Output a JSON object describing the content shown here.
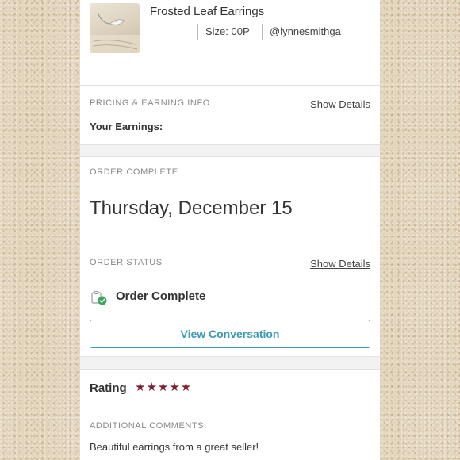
{
  "item": {
    "title": "Frosted Leaf Earrings",
    "size": "Size: 00P",
    "seller": "@lynnesmithga"
  },
  "pricing": {
    "heading": "PRICING & EARNING INFO",
    "show_details": "Show Details",
    "earnings_label": "Your Earnings:"
  },
  "order_complete": {
    "heading": "ORDER COMPLETE",
    "date": "Thursday, December 15"
  },
  "order_status": {
    "heading": "ORDER STATUS",
    "show_details": "Show Details",
    "status": "Order Complete",
    "status_color": "#3ba55c"
  },
  "actions": {
    "view_conversation": "View Conversation",
    "accent_color": "#3a9bb2"
  },
  "rating": {
    "label": "Rating",
    "stars_display": "★★★★★",
    "stars": 5,
    "max": 5,
    "star_color": "#7e2232"
  },
  "comments": {
    "heading": "ADDITIONAL COMMENTS:",
    "text": "Beautiful earrings from a great seller!"
  }
}
